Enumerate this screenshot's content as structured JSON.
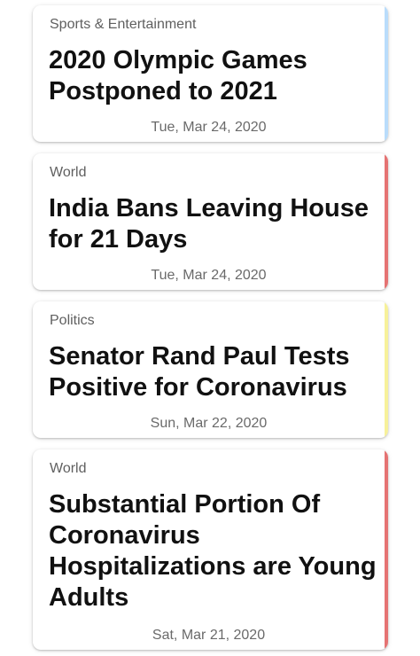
{
  "articles": [
    {
      "category": "Sports & Entertainment",
      "headline": "2020 Olympic Games Postponed to 2021",
      "date": "Tue, Mar 24, 2020",
      "accent_color": "#b9dcfb"
    },
    {
      "category": "World",
      "headline": "India Bans Leaving House for 21 Days",
      "date": "Tue, Mar 24, 2020",
      "accent_color": "#e57373"
    },
    {
      "category": "Politics",
      "headline": "Senator Rand Paul Tests Positive for Coronavirus",
      "date": "Sun, Mar 22, 2020",
      "accent_color": "#f7f19a"
    },
    {
      "category": "World",
      "headline": "Substantial Portion Of Coronavirus Hospitalizations are Young Adults",
      "date": "Sat, Mar 21, 2020",
      "accent_color": "#e57373"
    }
  ]
}
